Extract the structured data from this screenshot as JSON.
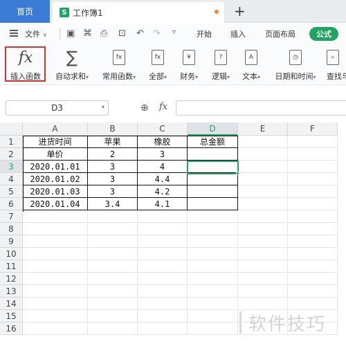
{
  "titlebar": {
    "home_tab": "首页",
    "doc_icon": "S",
    "doc_tab": "工作簿1",
    "unsaved_indicator": "dot-icon",
    "new_tab_icon": "plus-icon"
  },
  "menu": {
    "file": "文件",
    "tabs": [
      "开始",
      "插入",
      "页面布局",
      "公式"
    ],
    "active_tab": "公式",
    "accent_color": "#1fa463"
  },
  "ribbon": {
    "insert_function": "插入函数",
    "autosum": "自动求和",
    "common_functions": "常用函数",
    "all": "全部",
    "finance": "财务",
    "logic": "逻辑",
    "text": "文本",
    "datetime": "日期和时间",
    "lookup": "查找与",
    "icon_finance": "¥",
    "icon_logic": "?",
    "icon_text": "A",
    "icon_all": "fx"
  },
  "formula_bar": {
    "cell_ref": "D3",
    "fx_label": "fx",
    "value": ""
  },
  "columns": [
    "A",
    "B",
    "C",
    "D",
    "E",
    "F"
  ],
  "rows": [
    "1",
    "2",
    "3",
    "4",
    "5",
    "6",
    "7",
    "8",
    "9",
    "10",
    "11",
    "12",
    "13",
    "14",
    "15",
    "16"
  ],
  "table": [
    [
      "进货时间",
      "苹果",
      "橡胶",
      "总金额"
    ],
    [
      "单价",
      "2",
      "3",
      ""
    ],
    [
      "2020.01.01",
      "3",
      "4",
      ""
    ],
    [
      "2020.01.02",
      "3",
      "4.4",
      ""
    ],
    [
      "2020.01.03",
      "3",
      "4.2",
      ""
    ],
    [
      "2020.01.04",
      "3.4",
      "4.1",
      ""
    ]
  ],
  "selected_cell": "D3",
  "watermark": "软件技巧"
}
